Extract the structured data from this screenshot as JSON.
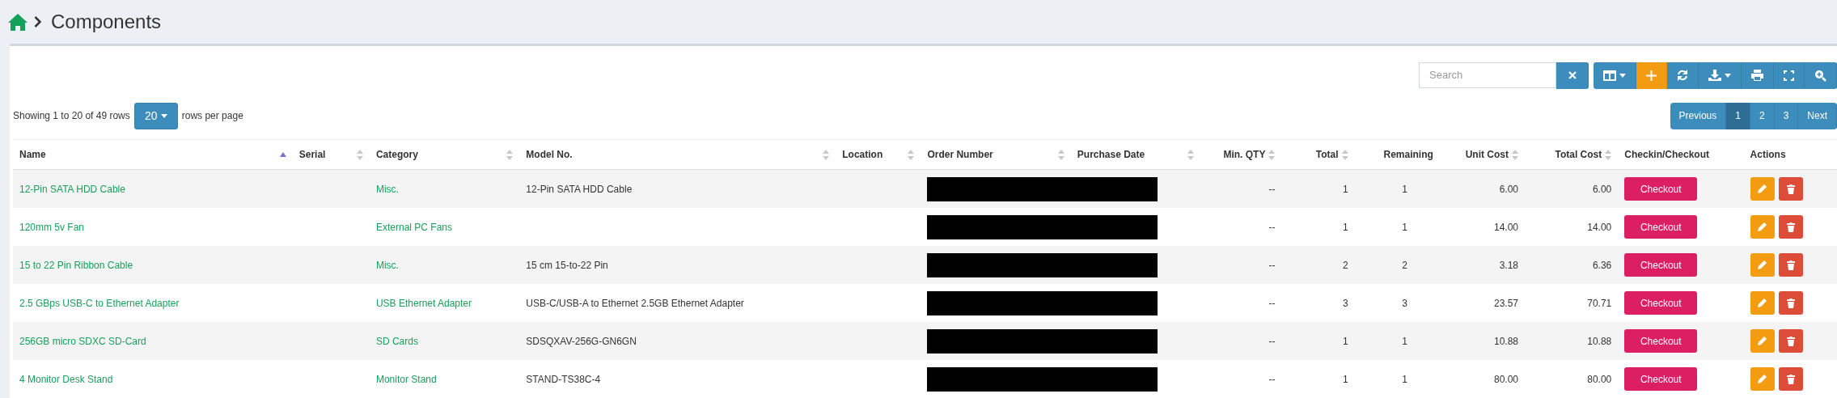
{
  "breadcrumb": {
    "title": "Components"
  },
  "toolbar": {
    "search": {
      "placeholder": "Search"
    },
    "buttons": [
      {
        "kind": "columns"
      },
      {
        "kind": "add"
      },
      {
        "kind": "refresh"
      },
      {
        "kind": "export"
      },
      {
        "kind": "print"
      },
      {
        "kind": "fullscreen"
      },
      {
        "kind": "zoom"
      }
    ]
  },
  "page_size": {
    "prefix": "Showing 1 to 20 of 49 rows",
    "value": "20",
    "suffix": "rows per page"
  },
  "pagination": [
    {
      "label": "Previous",
      "selected": false
    },
    {
      "label": "1",
      "selected": true
    },
    {
      "label": "2",
      "selected": false
    },
    {
      "label": "3",
      "selected": false
    },
    {
      "label": "Next",
      "selected": false
    }
  ],
  "table": {
    "columns": [
      {
        "label": "Name",
        "sortable": true,
        "sorted": true
      },
      {
        "label": "Serial",
        "sortable": true,
        "sorted": false
      },
      {
        "label": "Category",
        "sortable": true,
        "sorted": false
      },
      {
        "label": "Model No.",
        "sortable": true,
        "sorted": false
      },
      {
        "label": "Location",
        "sortable": true,
        "sorted": false
      },
      {
        "label": "Order Number",
        "sortable": true,
        "sorted": false
      },
      {
        "label": "Purchase Date",
        "sortable": true,
        "sorted": false
      },
      {
        "label": "Min. QTY",
        "sortable": true,
        "sorted": false
      },
      {
        "label": "Total",
        "sortable": true,
        "sorted": false
      },
      {
        "label": "Remaining",
        "sortable": false,
        "sorted": false
      },
      {
        "label": "Unit Cost",
        "sortable": true,
        "sorted": false
      },
      {
        "label": "Total Cost",
        "sortable": true,
        "sorted": false
      },
      {
        "label": "Checkin/Checkout",
        "sortable": false,
        "sorted": false
      },
      {
        "label": "Actions",
        "sortable": false,
        "sorted": false
      }
    ],
    "rows": [
      {
        "name": "12-Pin SATA HDD Cable",
        "category": "Misc.",
        "model": "12-Pin SATA HDD Cable",
        "redacted": true,
        "min_qty": "--",
        "total": "1",
        "remaining": "1",
        "unit_cost": "6.00",
        "total_cost": "6.00",
        "checkout": "Checkout"
      },
      {
        "name": "120mm 5v Fan",
        "category": "External PC Fans",
        "redacted": true,
        "min_qty": "--",
        "total": "1",
        "remaining": "1",
        "unit_cost": "14.00",
        "total_cost": "14.00",
        "checkout": "Checkout"
      },
      {
        "name": "15 to 22 Pin Ribbon Cable",
        "category": "Misc.",
        "model": "15 cm 15-to-22 Pin",
        "redacted": true,
        "min_qty": "--",
        "total": "2",
        "remaining": "2",
        "unit_cost": "3.18",
        "total_cost": "6.36",
        "checkout": "Checkout"
      },
      {
        "name": "2.5 GBps USB-C to Ethernet Adapter",
        "category": "USB Ethernet Adapter",
        "model": "USB-C/USB-A to Ethernet 2.5GB Ethernet Adapter",
        "redacted": true,
        "min_qty": "--",
        "total": "3",
        "remaining": "3",
        "unit_cost": "23.57",
        "total_cost": "70.71",
        "checkout": "Checkout"
      },
      {
        "name": "256GB micro SDXC SD-Card",
        "category": "SD Cards",
        "model": "SDSQXAV-256G-GN6GN",
        "redacted": true,
        "min_qty": "--",
        "total": "1",
        "remaining": "1",
        "unit_cost": "10.88",
        "total_cost": "10.88",
        "checkout": "Checkout"
      },
      {
        "name": "4 Monitor Desk Stand",
        "category": "Monitor Stand",
        "model": "STAND-TS38C-4",
        "redacted": true,
        "min_qty": "--",
        "total": "1",
        "remaining": "1",
        "unit_cost": "80.00",
        "total_cost": "80.00",
        "checkout": "Checkout"
      }
    ]
  }
}
